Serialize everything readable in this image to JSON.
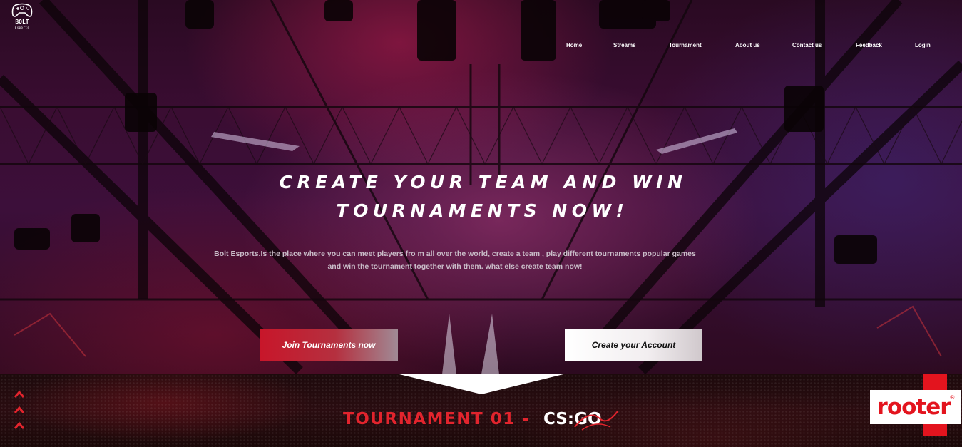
{
  "brand": {
    "logo_text": "BOLT",
    "logo_sub": "Esports"
  },
  "nav": {
    "items": [
      {
        "label": "Home"
      },
      {
        "label": "Streams"
      },
      {
        "label": "Tournament"
      },
      {
        "label": "About us"
      },
      {
        "label": "Contact us"
      },
      {
        "label": "Feedback"
      },
      {
        "label": "Login"
      }
    ]
  },
  "hero": {
    "headline_line1": "CREATE YOUR TEAM AND WIN",
    "headline_line2": "TOURNAMENTS NOW!",
    "description_line1": "Bolt Esports.Is the place where you can meet players fro m all over the world, create a team , play different tournaments popular games",
    "description_line2": "and win the tournament together with them. what else create team now!",
    "join_button": "Join Tournaments now",
    "create_button": "Create your Account"
  },
  "banner": {
    "tournament_label": "TOURNAMENT 01 -",
    "game_label": "CS:GO",
    "sponsor": "rooter"
  },
  "colors": {
    "accent_red": "#e2242d",
    "join_button_bg": "#c8162a",
    "create_button_bg": "#ffffff"
  }
}
